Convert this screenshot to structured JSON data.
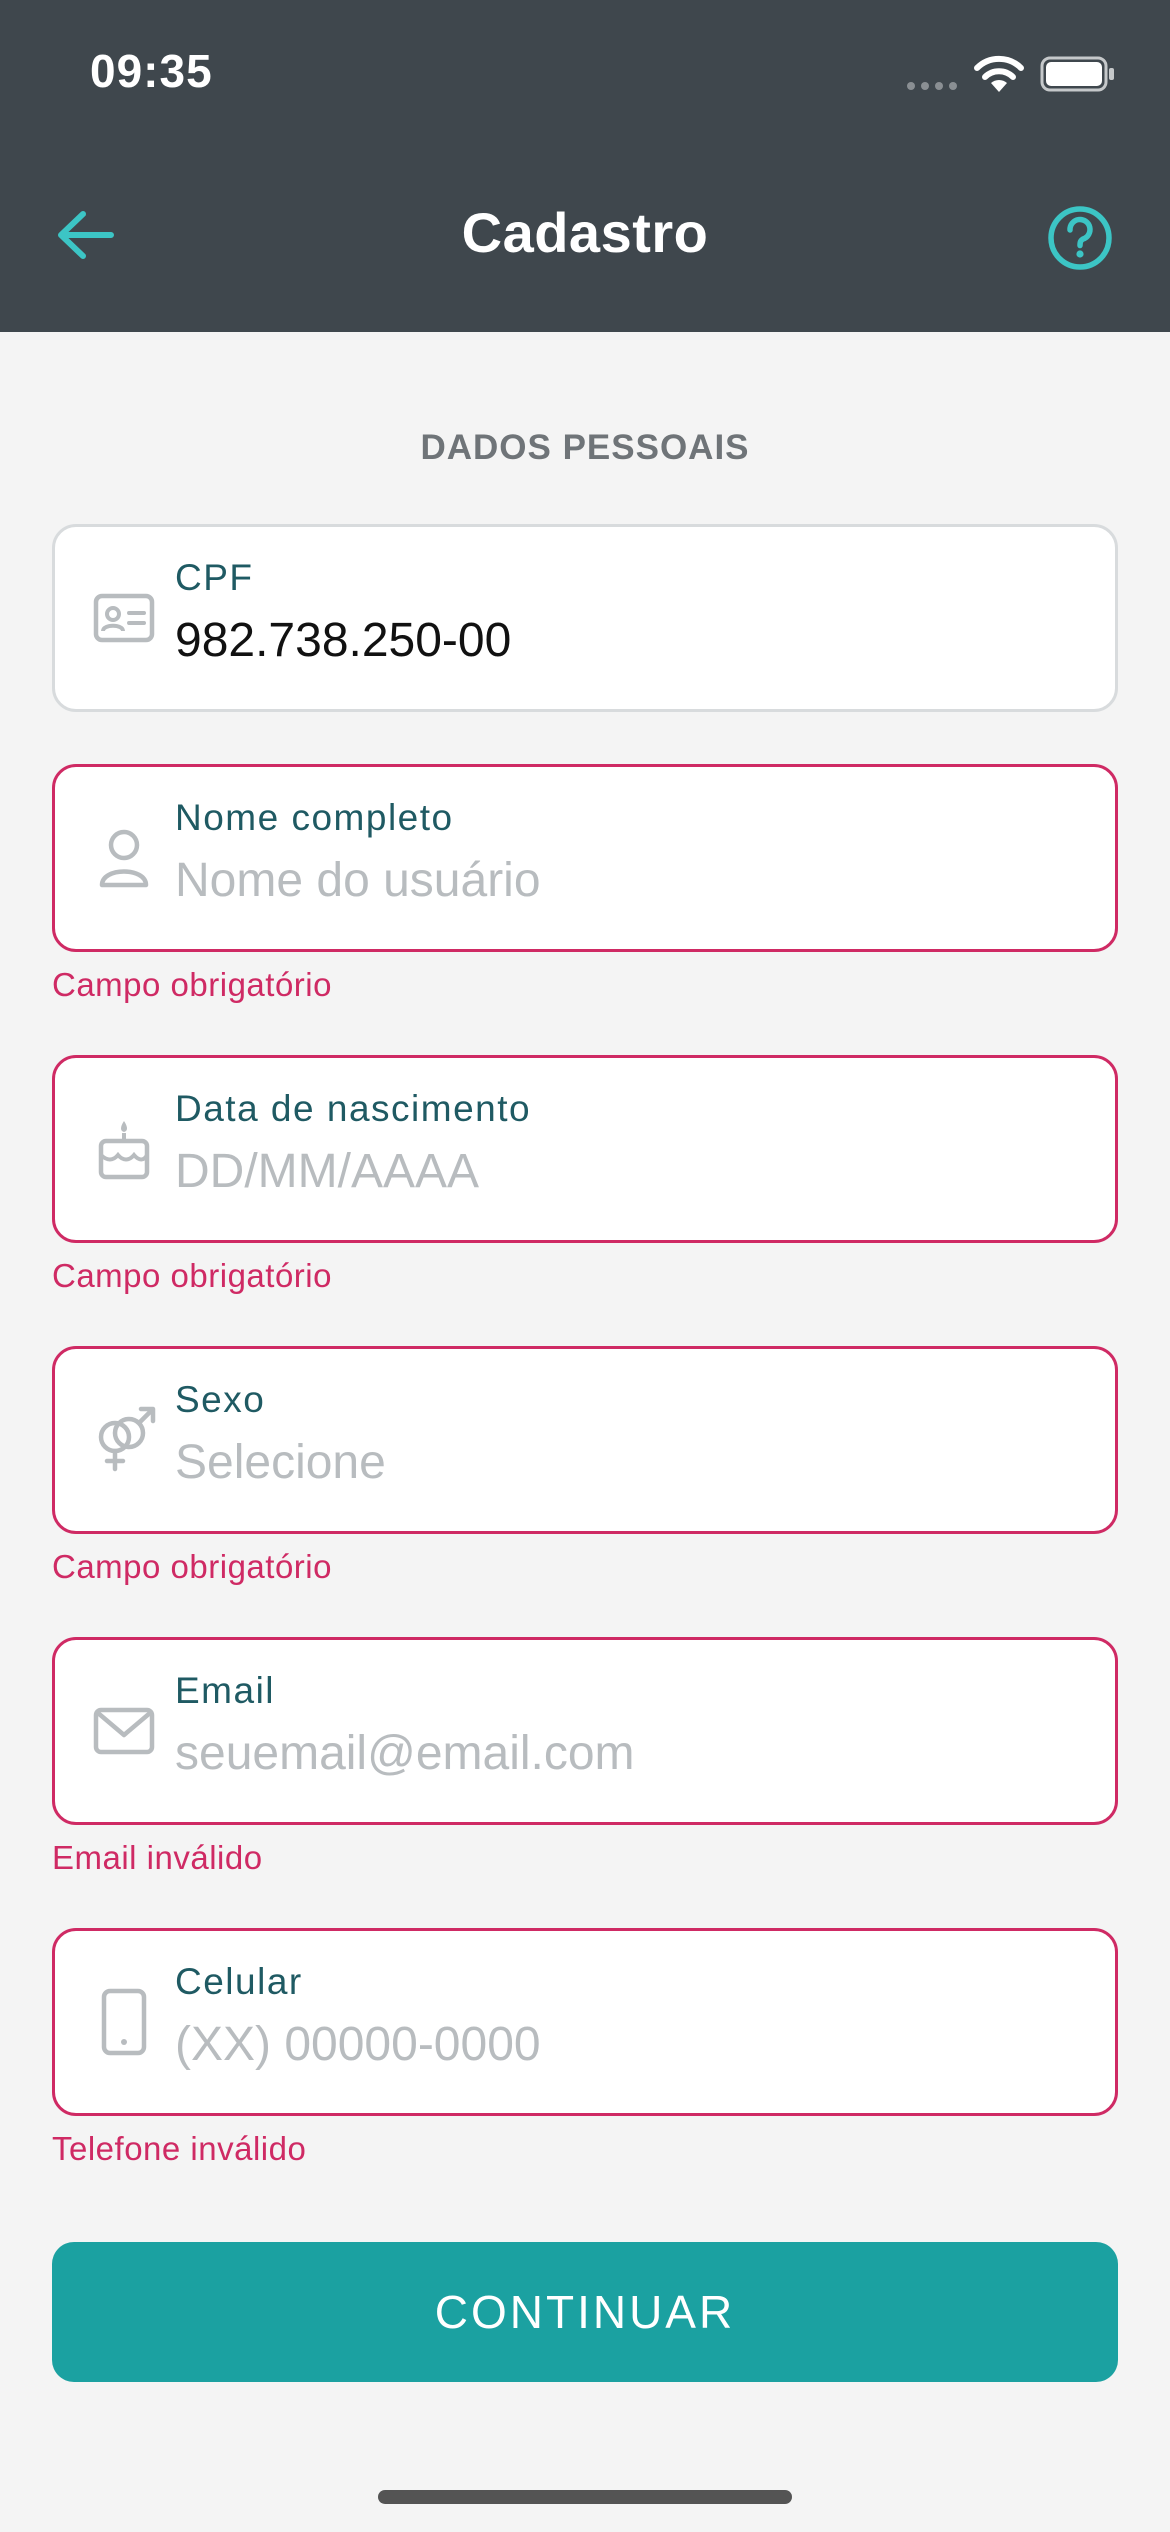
{
  "status_bar": {
    "time": "09:35"
  },
  "header": {
    "title": "Cadastro",
    "back_icon": "arrow-left-icon",
    "help_icon": "question-circle-icon",
    "accent_color": "#3cc5c5",
    "background_color": "#3f474d"
  },
  "section": {
    "title": "DADOS PESSOAIS"
  },
  "fields": {
    "cpf": {
      "label": "CPF",
      "value": "982.738.250-00",
      "icon": "id-card-icon"
    },
    "name": {
      "label": "Nome completo",
      "placeholder": "Nome do usuário",
      "icon": "user-icon",
      "error": "Campo obrigatório"
    },
    "birthdate": {
      "label": "Data de nascimento",
      "placeholder": "DD/MM/AAAA",
      "icon": "cake-icon",
      "error": "Campo obrigatório"
    },
    "sex": {
      "label": "Sexo",
      "placeholder": "Selecione",
      "icon": "gender-icon",
      "error": "Campo obrigatório"
    },
    "email": {
      "label": "Email",
      "placeholder": "seuemail@email.com",
      "icon": "envelope-icon",
      "error": "Email inválido"
    },
    "phone": {
      "label": "Celular",
      "placeholder": "(XX) 00000-0000",
      "icon": "smartphone-icon",
      "error": "Telefone inválido"
    }
  },
  "actions": {
    "continue_label": "CONTINUAR",
    "button_color": "#1ba1a1",
    "error_color": "#cf2a64"
  }
}
